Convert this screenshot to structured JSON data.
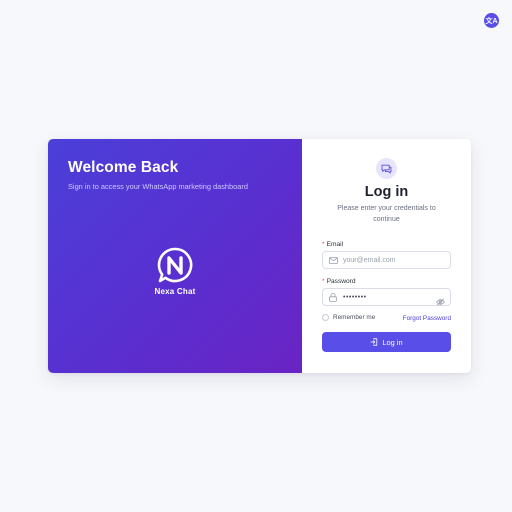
{
  "language_button": {
    "icon": "translate-icon",
    "glyph": "文A"
  },
  "brand": {
    "welcome_title": "Welcome Back",
    "welcome_subtitle": "Sign in to access your WhatsApp marketing dashboard",
    "logo_text": "Nexa Chat",
    "gradient_start": "#4b3fd9",
    "gradient_end": "#6a23c4"
  },
  "login": {
    "title": "Log in",
    "subtitle": "Please enter your credentials to continue",
    "email_label": "Email",
    "email_placeholder": "your@email.com",
    "password_label": "Password",
    "password_value": "••••••••",
    "remember_label": "Remember me",
    "forgot_label": "Forgot Password",
    "button_label": "Log in"
  },
  "colors": {
    "accent": "#5a4ee8",
    "required": "#e0455a"
  }
}
